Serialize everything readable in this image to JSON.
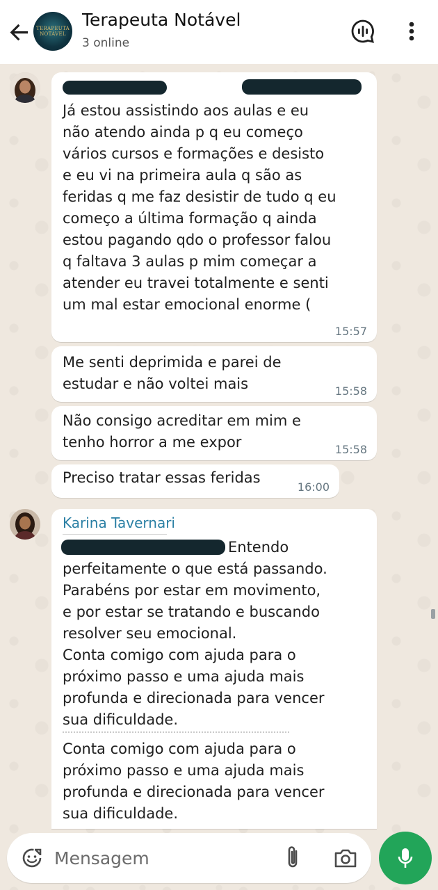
{
  "header": {
    "title": "Terapeuta Notável",
    "subtitle": "3 online",
    "avatar_text": "TERAPEUTA NOTÁVEL"
  },
  "messages": [
    {
      "text": "Já estou assistindo aos aulas e eu\nnão atendo ainda p q eu começo\nvários cursos e formações e desisto\ne eu vi na primeira aula q  são as\nferidas q me faz desistir de tudo q eu\ncomeço a última formação q ainda\nestou pagando qdo o professor falou\nq faltava 3 aulas p mim começar a\natender eu travei totalmente e senti\num mal estar emocional enorme (",
      "time": "15:57"
    },
    {
      "text": "Me senti deprimida e parei de\nestudar e não voltei mais",
      "time": "15:58"
    },
    {
      "text": "Não consigo acreditar em mim e\ntenho horror a me expor",
      "time": "15:58"
    },
    {
      "text": "Preciso tratar essas feridas",
      "time": "16:00"
    },
    {
      "sender": "Karina Tavernari",
      "text": "Entendo\nperfeitamente o que está passando.\nParabéns por estar em movimento,\ne por estar se tratando e buscando\nresolver seu emocional.\nConta comigo com ajuda para o\npróximo passo e uma ajuda mais\nprofunda e direcionada para vencer\nsua dificuldade.",
      "text2": "Conta comigo com ajuda para o\npróximo passo e uma ajuda mais\nprofunda e direcionada para vencer\nsua dificuldade."
    }
  ],
  "composer": {
    "placeholder": "Mensagem"
  },
  "colors": {
    "accent": "#22a559",
    "sender": "#2a7fa4",
    "bubble": "#ffffff",
    "wallpaper": "#efe8df"
  },
  "icons": [
    "back-arrow-icon",
    "voice-chat-icon",
    "more-vert-icon",
    "emoji-icon",
    "attach-icon",
    "camera-icon",
    "mic-icon"
  ]
}
